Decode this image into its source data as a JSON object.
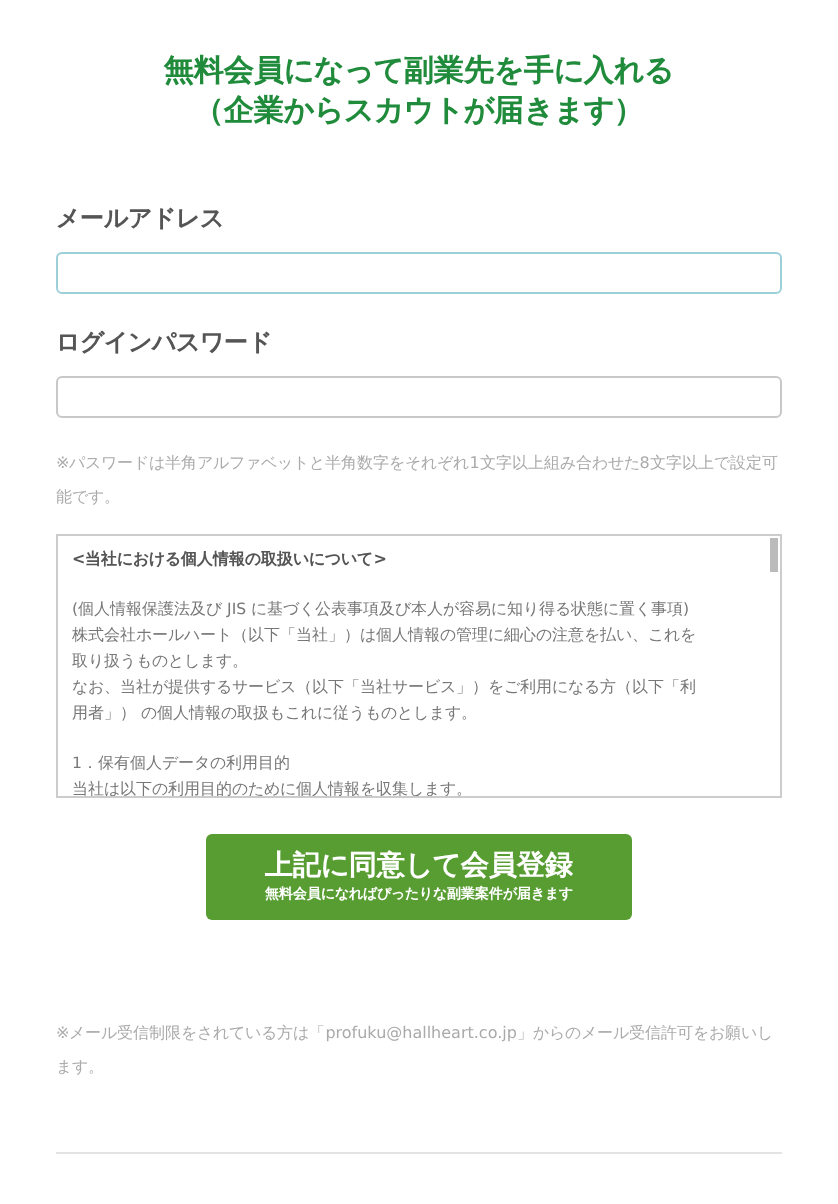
{
  "heading": [
    "無料会員になって副業先を手に入れる",
    "（企業からスカウトが届きます）"
  ],
  "fields": [
    {
      "label": "メールアドレス",
      "focused": true
    },
    {
      "label": "ログインパスワード",
      "focused": false
    }
  ],
  "password_note": "※パスワードは半角アルファベットと半角数字をそれぞれ1文字以上組み合わせた8文字以上で設定可能です。",
  "terms": {
    "title": "<当社における個人情報の取扱いについて>",
    "paragraphs": [
      [
        "(個人情報保護法及び JIS に基づく公表事項及び本人が容易に知り得る状態に置く事項)",
        "株式会社ホールハート（以下「当社」）は個人情報の管理に細心の注意を払い、これを",
        "取り扱うものとします。",
        "なお、当社が提供するサービス（以下「当社サービス」）をご利用になる方（以下「利",
        "用者」） の個人情報の取扱もこれに従うものとします。"
      ],
      [
        "1．保有個人データの利用目的",
        "当社は以下の利用目的のために個人情報を収集します。"
      ]
    ]
  },
  "submit": {
    "label": "上記に同意して会員登録",
    "sublabel": "無料会員になればぴったりな副業案件が届きます"
  },
  "mail_note": "※メール受信制限をされている方は「profuku@hallheart.co.jp」からのメール受信許可をお願いします。"
}
